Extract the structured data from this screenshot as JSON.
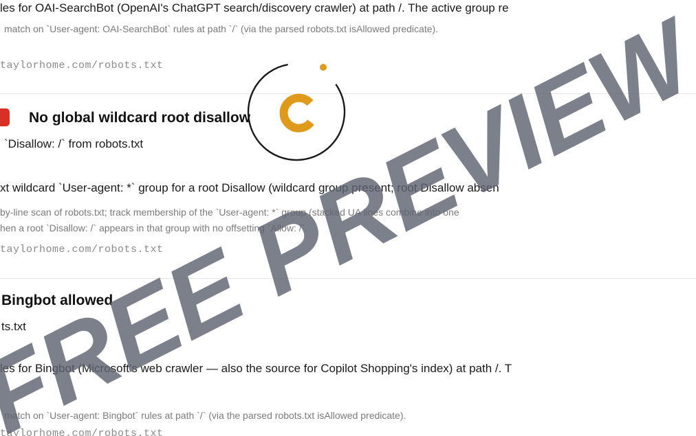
{
  "check1": {
    "rule_text": "les for OAI-SearchBot (OpenAI's ChatGPT search/discovery crawler) at path /. The active group re",
    "method": "match on `User-agent: OAI-SearchBot` rules at path `/` (via the parsed robots.txt isAllowed predicate).",
    "source_url": "taylorhome.com/robots.txt"
  },
  "check2": {
    "title": "No global wildcard root disallow",
    "description": "`Disallow: /` from robots.txt",
    "rule_text": "xt wildcard `User-agent: *` group for a root Disallow (wildcard group present; root Disallow absen",
    "method_line1": "by-line scan of robots.txt; track membership of the `User-agent: *` group (stacked UA lines combine into one",
    "method_line2": "hen a root `Disallow: /` appears in that group with no offsetting `Allow: /`.",
    "source_url": "taylorhome.com/robots.txt"
  },
  "check3": {
    "title": "Bingbot allowed",
    "description": "ts.txt",
    "rule_text": "les for Bingbot (Microsoft's web crawler — also the source for Copilot Shopping's index) at path /. T",
    "method": "match on `User-agent: Bingbot` rules at path `/` (via the parsed robots.txt isAllowed predicate).",
    "source_url": "taylorhome.com/robots.txt"
  },
  "watermark": {
    "text": "FREE PREVIEW"
  },
  "colors": {
    "fail": "#d93025",
    "logo_accent": "#e09a1b",
    "watermark": "#5f6470"
  },
  "icons": {
    "fail_status": "fail-status-icon",
    "logo": "brand-logo-icon"
  }
}
